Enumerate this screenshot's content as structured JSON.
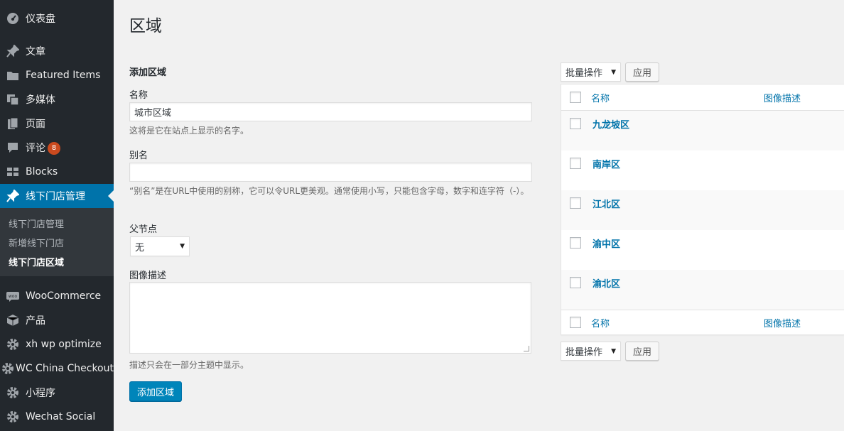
{
  "sidebar": {
    "items": [
      {
        "label": "仪表盘",
        "icon": "dashboard-icon"
      },
      {
        "label": "文章",
        "icon": "pin-icon"
      },
      {
        "label": "Featured Items",
        "icon": "folder-icon"
      },
      {
        "label": "多媒体",
        "icon": "media-icon"
      },
      {
        "label": "页面",
        "icon": "pages-icon"
      },
      {
        "label": "评论",
        "icon": "comment-icon",
        "badge": "8"
      },
      {
        "label": "Blocks",
        "icon": "blocks-icon"
      },
      {
        "label": "线下门店管理",
        "icon": "pin-icon",
        "current": true
      },
      {
        "label": "WooCommerce",
        "icon": "woo-icon"
      },
      {
        "label": "产品",
        "icon": "box-icon"
      },
      {
        "label": "xh wp optimize",
        "icon": "gear-icon"
      },
      {
        "label": "WC China Checkout",
        "icon": "gear-icon"
      },
      {
        "label": "小程序",
        "icon": "gear-icon"
      },
      {
        "label": "Wechat Social",
        "icon": "gear-icon"
      }
    ],
    "submenu": [
      {
        "label": "线下门店管理"
      },
      {
        "label": "新增线下门店"
      },
      {
        "label": "线下门店区域",
        "current": true
      }
    ]
  },
  "page": {
    "title": "区域"
  },
  "form": {
    "heading": "添加区域",
    "name_label": "名称",
    "name_value": "城市区域",
    "name_help": "这将是它在站点上显示的名字。",
    "slug_label": "别名",
    "slug_value": "",
    "slug_help": "“别名”是在URL中使用的别称，它可以令URL更美观。通常使用小写，只能包含字母，数字和连字符（-）。",
    "parent_label": "父节点",
    "parent_value": "无",
    "desc_label": "图像描述",
    "desc_help": "描述只会在一部分主题中显示。",
    "submit_label": "添加区域"
  },
  "table": {
    "bulk_label": "批量操作",
    "apply_label": "应用",
    "col_name": "名称",
    "col_desc": "图像描述",
    "rows": [
      "九龙坡区",
      "南岸区",
      "江北区",
      "渝中区",
      "渝北区"
    ]
  },
  "colors": {
    "accent": "#0073aa",
    "sidebar_bg": "#23282d",
    "badge": "#ca4a1f"
  }
}
